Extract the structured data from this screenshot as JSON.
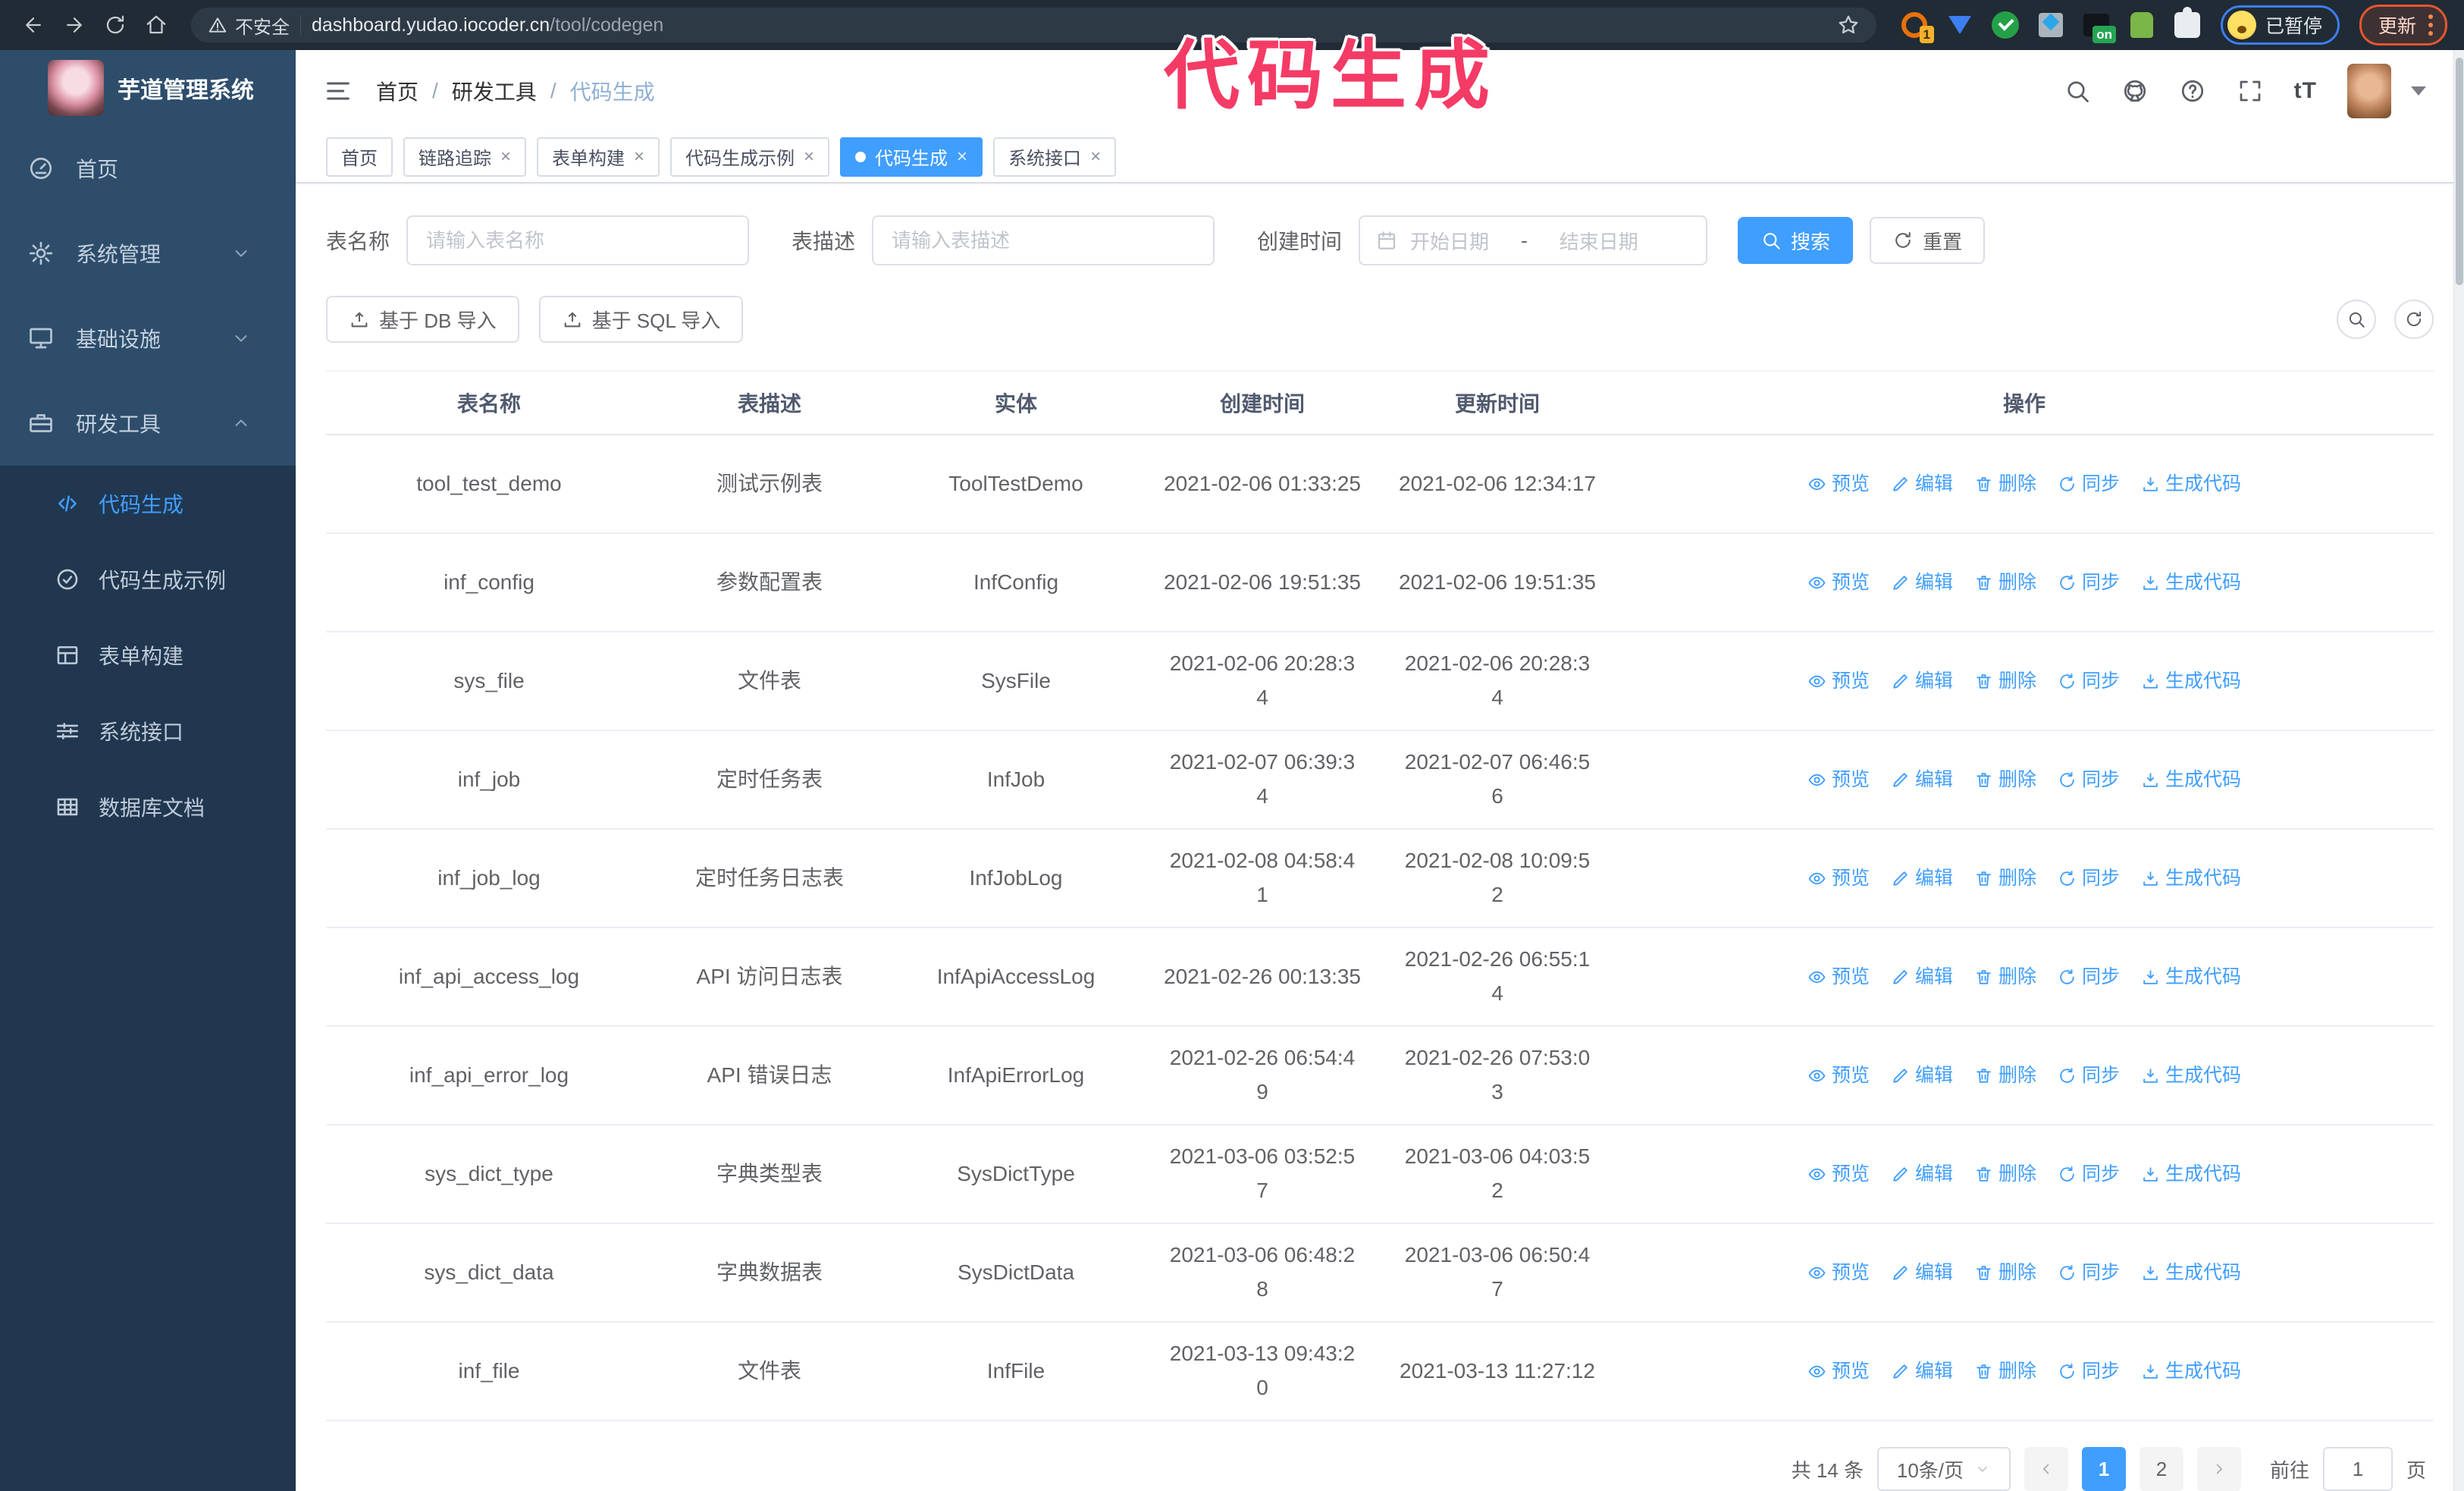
{
  "colors": {
    "accent": "#409eff",
    "sidebar_bg": "#2d4d6b",
    "submenu_bg": "#20374f",
    "overlay_pink": "#f43b66",
    "chrome_bg": "#212b35"
  },
  "overlay": {
    "title": "代码生成"
  },
  "browser": {
    "insecure_label": "不安全",
    "url_host": "dashboard.yudao.iocoder.cn",
    "url_path": "/tool/codegen",
    "extensions": [
      {
        "name": "extension-icon-1",
        "style": "ext1",
        "badge": "1"
      },
      {
        "name": "extension-icon-2",
        "style": "ext2",
        "badge": ""
      },
      {
        "name": "extension-icon-3",
        "style": "ext3",
        "badge": ""
      },
      {
        "name": "extension-icon-4",
        "style": "ext4",
        "badge": ""
      },
      {
        "name": "extension-icon-5",
        "style": "ext5",
        "badge": "on"
      },
      {
        "name": "extension-icon-6",
        "style": "ext6",
        "badge": ""
      },
      {
        "name": "extension-icon-7",
        "style": "ext7",
        "badge": ""
      }
    ],
    "paused_badge": "已暂停",
    "update_button": "更新"
  },
  "sidebar": {
    "app_title": "芋道管理系统",
    "items": [
      {
        "label": "首页",
        "icon": "dashboard-icon",
        "chevron": ""
      },
      {
        "label": "系统管理",
        "icon": "gear-icon",
        "chevron": "down"
      },
      {
        "label": "基础设施",
        "icon": "monitor-icon",
        "chevron": "down"
      },
      {
        "label": "研发工具",
        "icon": "toolbox-icon",
        "chevron": "up"
      }
    ],
    "submenu": [
      {
        "label": "代码生成",
        "icon": "code-icon",
        "active": true
      },
      {
        "label": "代码生成示例",
        "icon": "example-icon",
        "active": false
      },
      {
        "label": "表单构建",
        "icon": "form-icon",
        "active": false
      },
      {
        "label": "系统接口",
        "icon": "api-icon",
        "active": false
      },
      {
        "label": "数据库文档",
        "icon": "database-icon",
        "active": false
      }
    ]
  },
  "navbar": {
    "breadcrumb": [
      "首页",
      "研发工具",
      "代码生成"
    ],
    "separator": "/",
    "font_size_icon_text": "tT"
  },
  "tags": [
    {
      "label": "首页",
      "closable": false,
      "active": false
    },
    {
      "label": "链路追踪",
      "closable": true,
      "active": false
    },
    {
      "label": "表单构建",
      "closable": true,
      "active": false
    },
    {
      "label": "代码生成示例",
      "closable": true,
      "active": false
    },
    {
      "label": "代码生成",
      "closable": true,
      "active": true
    },
    {
      "label": "系统接口",
      "closable": true,
      "active": false
    }
  ],
  "filters": {
    "table_name_label": "表名称",
    "table_name_placeholder": "请输入表名称",
    "table_desc_label": "表描述",
    "table_desc_placeholder": "请输入表描述",
    "create_time_label": "创建时间",
    "date_start_placeholder": "开始日期",
    "date_separator": "-",
    "date_end_placeholder": "结束日期",
    "search_button": "搜索",
    "reset_button": "重置"
  },
  "toolbar": {
    "import_db_button": "基于 DB 导入",
    "import_sql_button": "基于 SQL 导入"
  },
  "table": {
    "columns": [
      "表名称",
      "表描述",
      "实体",
      "创建时间",
      "更新时间",
      "操作"
    ],
    "actions": [
      {
        "label": "预览",
        "icon": "eye-icon"
      },
      {
        "label": "编辑",
        "icon": "pencil-icon"
      },
      {
        "label": "删除",
        "icon": "trash-icon"
      },
      {
        "label": "同步",
        "icon": "sync-icon"
      },
      {
        "label": "生成代码",
        "icon": "download-icon"
      }
    ],
    "rows": [
      {
        "name": "tool_test_demo",
        "desc": "测试示例表",
        "entity": "ToolTestDemo",
        "created": "2021-02-06 01:33:25",
        "updated": "2021-02-06 12:34:17"
      },
      {
        "name": "inf_config",
        "desc": "参数配置表",
        "entity": "InfConfig",
        "created": "2021-02-06 19:51:35",
        "updated": "2021-02-06 19:51:35"
      },
      {
        "name": "sys_file",
        "desc": "文件表",
        "entity": "SysFile",
        "created": "2021-02-06 20:28:3\n4",
        "updated": "2021-02-06 20:28:3\n4"
      },
      {
        "name": "inf_job",
        "desc": "定时任务表",
        "entity": "InfJob",
        "created": "2021-02-07 06:39:3\n4",
        "updated": "2021-02-07 06:46:5\n6"
      },
      {
        "name": "inf_job_log",
        "desc": "定时任务日志表",
        "entity": "InfJobLog",
        "created": "2021-02-08 04:58:4\n1",
        "updated": "2021-02-08 10:09:5\n2"
      },
      {
        "name": "inf_api_access_log",
        "desc": "API 访问日志表",
        "entity": "InfApiAccessLog",
        "created": "2021-02-26 00:13:35",
        "updated": "2021-02-26 06:55:1\n4"
      },
      {
        "name": "inf_api_error_log",
        "desc": "API 错误日志",
        "entity": "InfApiErrorLog",
        "created": "2021-02-26 06:54:4\n9",
        "updated": "2021-02-26 07:53:0\n3"
      },
      {
        "name": "sys_dict_type",
        "desc": "字典类型表",
        "entity": "SysDictType",
        "created": "2021-03-06 03:52:5\n7",
        "updated": "2021-03-06 04:03:5\n2"
      },
      {
        "name": "sys_dict_data",
        "desc": "字典数据表",
        "entity": "SysDictData",
        "created": "2021-03-06 06:48:2\n8",
        "updated": "2021-03-06 06:50:4\n7"
      },
      {
        "name": "inf_file",
        "desc": "文件表",
        "entity": "InfFile",
        "created": "2021-03-13 09:43:2\n0",
        "updated": "2021-03-13 11:27:12"
      }
    ]
  },
  "pagination": {
    "total_text": "共 14 条",
    "page_size": "10条/页",
    "pages": [
      "1",
      "2"
    ],
    "active_page": "1",
    "goto_label": "前往",
    "goto_value": "1",
    "goto_suffix": "页"
  }
}
